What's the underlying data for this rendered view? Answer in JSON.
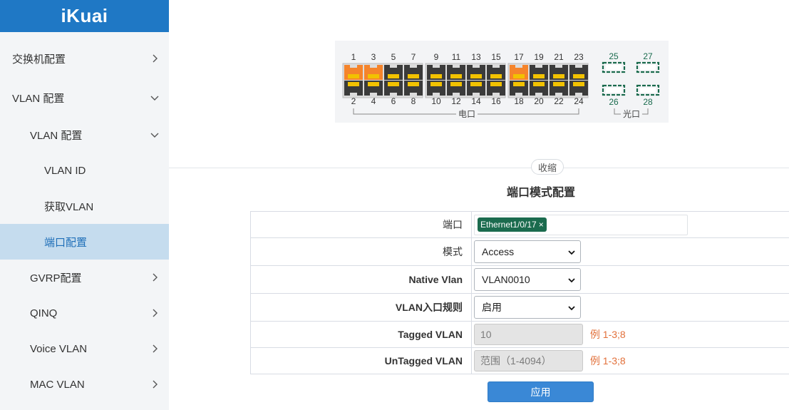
{
  "brand": {
    "logo": "iKuai",
    "color": "#1f78c5"
  },
  "sidebar": {
    "items": [
      {
        "label": "交换机配置",
        "chevron": "right"
      },
      {
        "label": "VLAN 配置",
        "chevron": "down"
      },
      {
        "label": "VLAN 配置",
        "chevron": "down"
      },
      {
        "label": "VLAN ID"
      },
      {
        "label": "获取VLAN"
      },
      {
        "label": "端口配置",
        "active": true
      },
      {
        "label": "GVRP配置",
        "chevron": "right"
      },
      {
        "label": "QINQ",
        "chevron": "right"
      },
      {
        "label": "Voice VLAN",
        "chevron": "right"
      },
      {
        "label": "MAC VLAN",
        "chevron": "right"
      }
    ]
  },
  "switch_panel": {
    "top_numbers": [
      "1",
      "3",
      "5",
      "7",
      "9",
      "11",
      "13",
      "15",
      "17",
      "19",
      "21",
      "23"
    ],
    "bottom_numbers": [
      "2",
      "4",
      "6",
      "8",
      "10",
      "12",
      "14",
      "16",
      "18",
      "20",
      "22",
      "24"
    ],
    "sfp_top": [
      "25",
      "27"
    ],
    "sfp_bottom": [
      "26",
      "28"
    ],
    "electrical_label": "电口",
    "optical_label": "光口",
    "active_ports": [
      "1",
      "3",
      "17"
    ],
    "colors": {
      "active": "#f5842b",
      "inactive": "#3b3b3b",
      "sfp": "#1b6b4e"
    }
  },
  "collapse_label": "收缩",
  "form": {
    "title": "端口模式配置",
    "port_label": "端口",
    "port_tag": "Ethernet1/0/17",
    "port_tag_close": "×",
    "mode_label": "模式",
    "mode_value": "Access",
    "native_label": "Native Vlan",
    "native_value": "VLAN0010",
    "ingress_label": "VLAN入口规则",
    "ingress_value": "启用",
    "tagged_label": "Tagged VLAN",
    "tagged_value": "10",
    "tagged_hint": "例 1-3;8",
    "untagged_label": "UnTagged VLAN",
    "untagged_placeholder": "范围（1-4094）",
    "untagged_hint": "例 1-3;8",
    "apply_label": "应用"
  }
}
